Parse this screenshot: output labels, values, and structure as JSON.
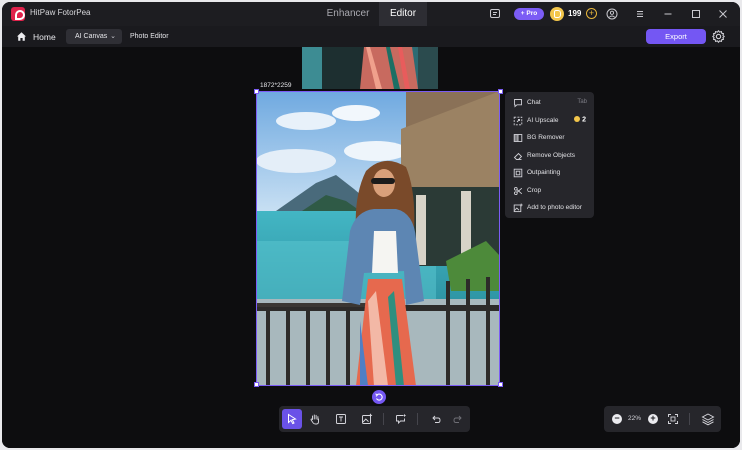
{
  "app": {
    "title": "HitPaw FotorPea",
    "tabs": [
      {
        "label": "Enhancer",
        "active": false
      },
      {
        "label": "Editor",
        "active": true
      }
    ],
    "pro_label": "+ Pro",
    "coins": "199"
  },
  "toolbar": {
    "home_label": "Home",
    "mode_select": "AI Canvas",
    "photo_editor_label": "Photo Editor",
    "export_label": "Export"
  },
  "canvas": {
    "image_dimensions": "1872*2259"
  },
  "context_menu": {
    "items": [
      {
        "label": "Chat",
        "shortcut": "Tab",
        "icon": "chat-icon"
      },
      {
        "label": "AI Upscale",
        "badge": "2",
        "icon": "upscale-icon"
      },
      {
        "label": "BG Remover",
        "icon": "bg-remover-icon"
      },
      {
        "label": "Remove Objects",
        "icon": "eraser-icon"
      },
      {
        "label": "Outpainting",
        "icon": "outpainting-icon"
      },
      {
        "label": "Crop",
        "icon": "crop-icon"
      },
      {
        "label": "Add to photo editor",
        "icon": "add-image-icon"
      }
    ]
  },
  "zoom": {
    "value": "22%"
  },
  "colors": {
    "accent": "#7457f3",
    "coin": "#f3c64b",
    "background": "#0d0d0f",
    "panel": "#26262b"
  }
}
